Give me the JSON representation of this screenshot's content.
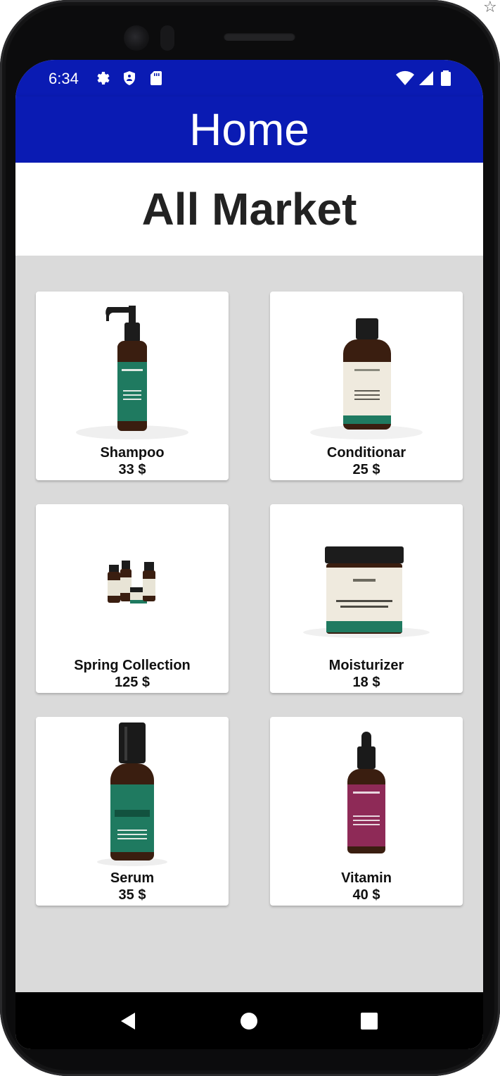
{
  "status_bar": {
    "time": "6:34",
    "left_icons": [
      "gear-icon",
      "shield-icon",
      "sd-card-icon"
    ],
    "right_icons": [
      "wifi-icon",
      "signal-icon",
      "battery-icon"
    ],
    "color": "#0a1bb3"
  },
  "app_bar": {
    "title": "Home",
    "color": "#0a1bb3"
  },
  "section": {
    "title": "All Market"
  },
  "products": [
    {
      "name": "Shampoo",
      "price": "33 $",
      "image": "pump-bottle-green-label"
    },
    {
      "name": "Conditionar",
      "price": "25 $",
      "image": "bottle-cream-label"
    },
    {
      "name": "Spring Collection",
      "price": "125 $",
      "image": "product-set"
    },
    {
      "name": "Moisturizer",
      "price": "18 $",
      "image": "cream-jar"
    },
    {
      "name": "Serum",
      "price": "35 $",
      "image": "spray-bottle-green"
    },
    {
      "name": "Vitamin",
      "price": "40 $",
      "image": "dropper-bottle-pink"
    }
  ],
  "nav_bar": {
    "buttons": [
      "back-icon",
      "home-icon",
      "recents-icon"
    ]
  },
  "colors": {
    "brand_green": "#1f7a60",
    "bottle_brown": "#3a1e10",
    "background": "#dadada"
  }
}
